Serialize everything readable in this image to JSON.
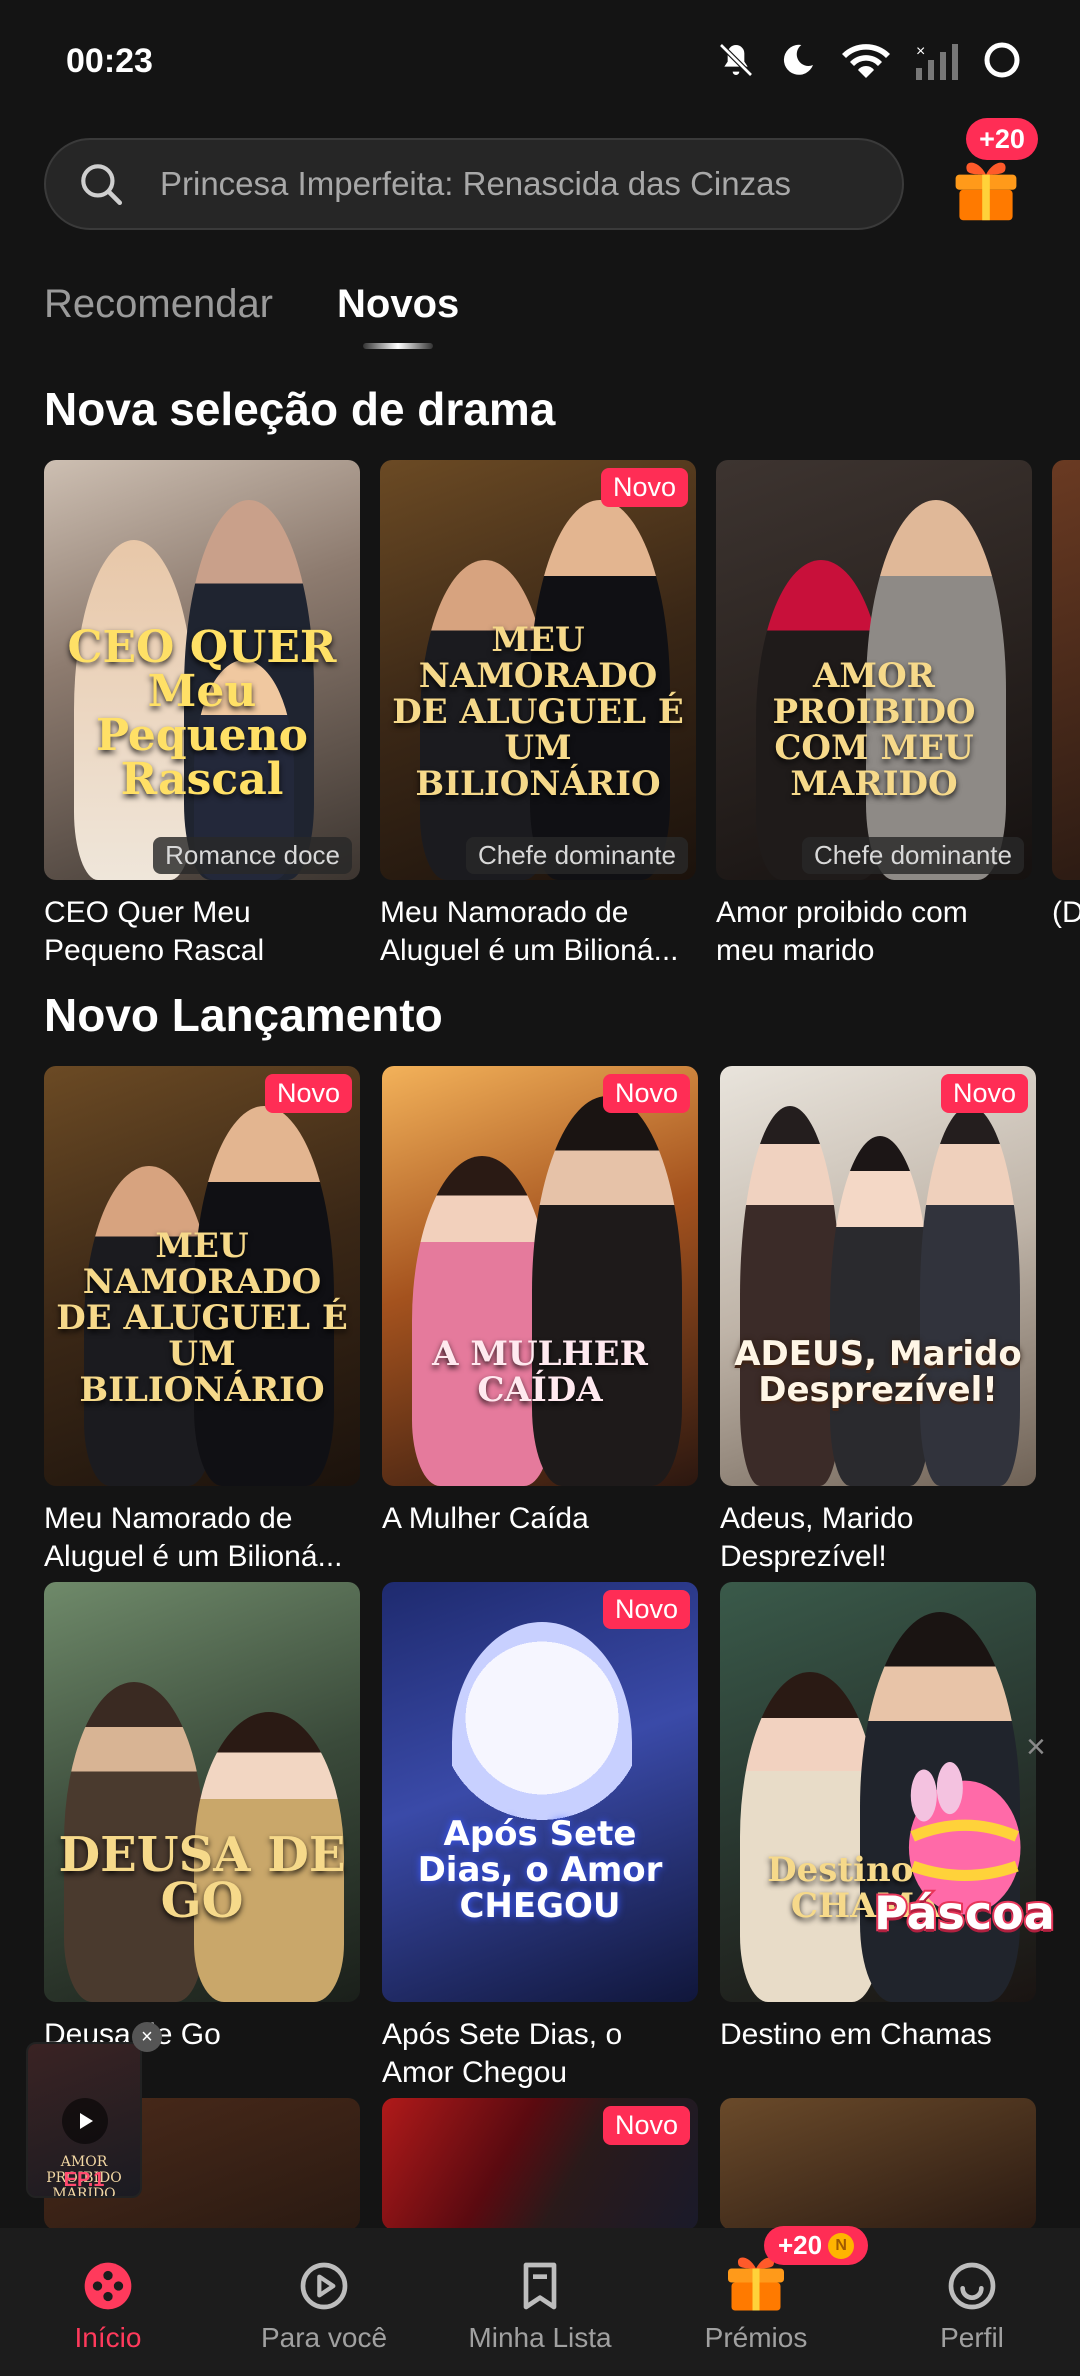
{
  "status": {
    "time": "00:23"
  },
  "search": {
    "placeholder": "Princesa Imperfeita: Renascida das Cinzas"
  },
  "reward_badge": "+20",
  "tabs": [
    {
      "label": "Recomendar",
      "active": false
    },
    {
      "label": "Novos",
      "active": true
    }
  ],
  "sections": {
    "drama": {
      "title": "Nova seleção de drama",
      "cards": [
        {
          "name": "CEO Quer Meu Pequeno Rascal",
          "tag": "Romance doce",
          "poster_text": "CEO QUER Meu Pequeno Rascal",
          "is_new": false
        },
        {
          "name": "Meu Namorado de Aluguel é um Bilioná...",
          "tag": "Chefe dominante",
          "poster_text": "MEU NAMORADO DE ALUGUEL É UM BILIONÁRIO",
          "is_new": true
        },
        {
          "name": "Amor proibido com meu marido",
          "tag": "Chefe dominante",
          "poster_text": "AMOR PROIBIDO COM MEU MARIDO",
          "is_new": false
        },
        {
          "name": "(D Pe",
          "tag": "",
          "poster_text": "",
          "is_new": false
        }
      ]
    },
    "release": {
      "title": "Novo Lançamento",
      "cards": [
        {
          "name": "Meu Namorado de Aluguel é um Bilioná...",
          "poster_text": "MEU NAMORADO DE ALUGUEL É UM BILIONÁRIO",
          "is_new": true
        },
        {
          "name": "A Mulher Caída",
          "poster_text": "A MULHER CAÍDA",
          "is_new": true
        },
        {
          "name": "Adeus, Marido Desprezível!",
          "poster_text": "ADEUS, Marido Desprezível!",
          "is_new": true
        },
        {
          "name": "Deusa de Go",
          "poster_text": "DEUSA DE GO",
          "is_new": false
        },
        {
          "name": "Após Sete Dias, o Amor Chegou",
          "poster_text": "Após Sete Dias, o Amor CHEGOU",
          "is_new": true
        },
        {
          "name": "Destino em Chamas",
          "poster_text": "Destino EM CHAMAS",
          "is_new": false
        },
        {
          "name": "",
          "poster_text": "",
          "is_new": false
        },
        {
          "name": "",
          "poster_text": "",
          "is_new": true
        },
        {
          "name": "",
          "poster_text": "",
          "is_new": false
        }
      ]
    }
  },
  "new_label": "Novo",
  "mini_player": {
    "title": "AMOR PROIBIDO MARIDO",
    "episode": "EP.1"
  },
  "promo": {
    "label": "Páscoa"
  },
  "nav": [
    {
      "label": "Início",
      "icon": "home-reel-icon",
      "active": true
    },
    {
      "label": "Para você",
      "icon": "play-circle-icon",
      "active": false
    },
    {
      "label": "Minha Lista",
      "icon": "bookmark-icon",
      "active": false
    },
    {
      "label": "Prémios",
      "icon": "gift-icon",
      "active": false,
      "badge": "+20"
    },
    {
      "label": "Perfil",
      "icon": "profile-icon",
      "active": false
    }
  ],
  "colors": {
    "accent": "#ff2d55",
    "background": "#141414"
  }
}
